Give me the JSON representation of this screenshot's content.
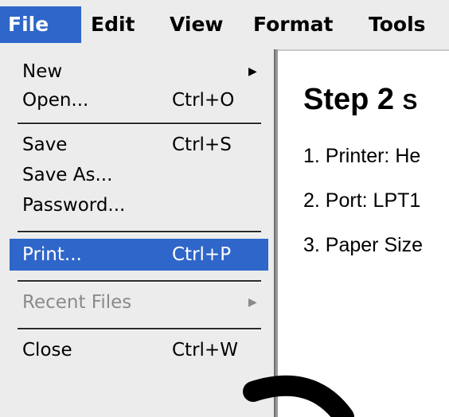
{
  "menubar": {
    "file": "File",
    "edit": "Edit",
    "view": "View",
    "format": "Format",
    "tools": "Tools"
  },
  "file_menu": {
    "new": {
      "label": "New"
    },
    "open": {
      "label": "Open...",
      "shortcut": "Ctrl+O"
    },
    "save": {
      "label": "Save",
      "shortcut": "Ctrl+S"
    },
    "save_as": {
      "label": "Save As..."
    },
    "password": {
      "label": "Password..."
    },
    "print": {
      "label": "Print...",
      "shortcut": "Ctrl+P"
    },
    "recent_files": {
      "label": "Recent Files"
    },
    "close": {
      "label": "Close",
      "shortcut": "Ctrl+W"
    },
    "submenu_arrow": "▶"
  },
  "document": {
    "step": "Step 2",
    "step_sub": "S",
    "line_1": "1. Printer: He",
    "line_2": "2. Port: LPT1",
    "line_3": "3. Paper Size"
  },
  "colors": {
    "highlight": "#2f66c9",
    "menu_background": "#ececec",
    "disabled_text": "#8a8a8a"
  }
}
